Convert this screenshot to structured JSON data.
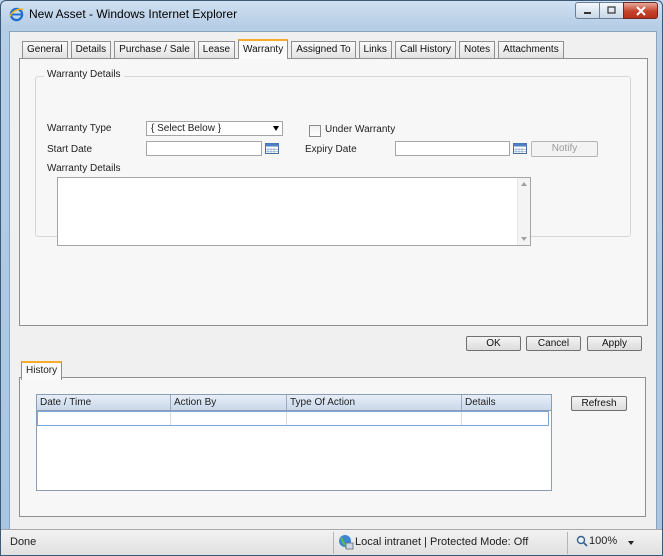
{
  "window": {
    "title": "New Asset - Windows Internet Explorer"
  },
  "tabs": [
    "General",
    "Details",
    "Purchase / Sale",
    "Lease",
    "Warranty",
    "Assigned To",
    "Links",
    "Call History",
    "Notes",
    "Attachments"
  ],
  "active_tab": "Warranty",
  "warranty": {
    "group_title": "Warranty Details",
    "type_label": "Warranty Type",
    "type_value": "{ Select Below }",
    "under_warranty_label": "Under Warranty",
    "start_date_label": "Start Date",
    "start_date_value": "",
    "expiry_date_label": "Expiry Date",
    "expiry_date_value": "",
    "notify_label": "Notify",
    "details_label": "Warranty Details",
    "details_value": ""
  },
  "actions": {
    "ok": "OK",
    "cancel": "Cancel",
    "apply": "Apply"
  },
  "history": {
    "tab": "History",
    "columns": [
      "Date / Time",
      "Action By",
      "Type Of Action",
      "Details"
    ],
    "refresh": "Refresh"
  },
  "statusbar": {
    "status": "Done",
    "zone": "Local intranet | Protected Mode: Off",
    "zoom": "100%"
  }
}
